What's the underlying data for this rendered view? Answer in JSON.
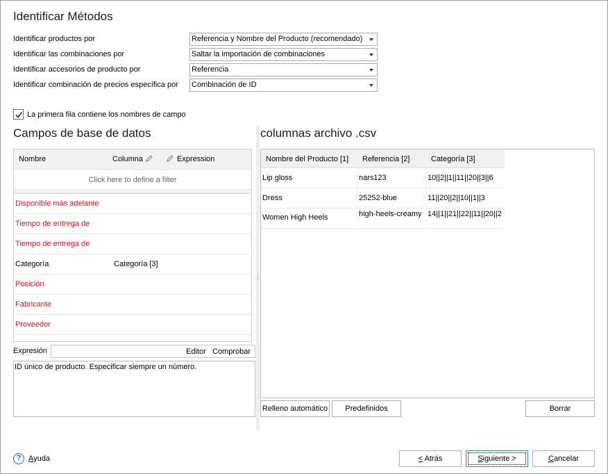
{
  "title": "Identificar Métodos",
  "methods": [
    {
      "label": "Identificar productos por",
      "value": "Referencia y Nombre del Producto (recomendado)"
    },
    {
      "label": "Identificar las combinaciones por",
      "value": "Saltar la importación de combinaciones"
    },
    {
      "label": "Identificar accesorios de producto por",
      "value": "Referencia"
    },
    {
      "label": "Identificar combinación de precios específica por",
      "value": "Combinación de ID"
    }
  ],
  "first_row_checkbox": {
    "label": "La primera fila contiene los nombres de campo",
    "checked": true
  },
  "db_fields": {
    "title": "Campos de base de datos",
    "headers": {
      "name": "Nombre",
      "column": "Columna",
      "expression": "Expression"
    },
    "filter_text": "Click here to define a filter",
    "rows": [
      {
        "name": "Disponible más adelante",
        "column": "",
        "required": true
      },
      {
        "name": "Tiempo de entrega de",
        "column": "",
        "required": true
      },
      {
        "name": "Tiempo de entrega de",
        "column": "",
        "required": true
      },
      {
        "name": "Categoría",
        "column": "Categoría [3]",
        "required": false
      },
      {
        "name": "Posición",
        "column": "",
        "required": true
      },
      {
        "name": "Fabricante",
        "column": "",
        "required": true
      },
      {
        "name": "Proveedor",
        "column": "",
        "required": true
      }
    ]
  },
  "expression": {
    "label": "Expresión",
    "editor_label": "Editor",
    "check_label": "Comprobar",
    "description": "ID único de producto. Especificar siempre un número."
  },
  "csv": {
    "title": "columnas archivo .csv",
    "headers": [
      "Nombre del Producto [1]",
      "Referencia [2]",
      "Categoría [3]"
    ],
    "rows": [
      [
        "Lip gloss",
        "nars123",
        "10||2||1||11||20||3||6"
      ],
      [
        "Dress",
        "25252-blue",
        "11||20||2||10||1||3"
      ],
      [
        "Women High Heels",
        "high-heels-creamy",
        "14||1||21||22||11||20||2"
      ]
    ]
  },
  "buttons": {
    "autofill": "Relleno automático",
    "predefined": "Predefinidos",
    "clear": "Borrar",
    "back": "< Atrás",
    "next": "Siguiente >",
    "cancel": "Cancelar",
    "help": "Ayuda"
  },
  "colors": {
    "required_field": "#d0121b",
    "help_icon": "#1f6fbf"
  }
}
